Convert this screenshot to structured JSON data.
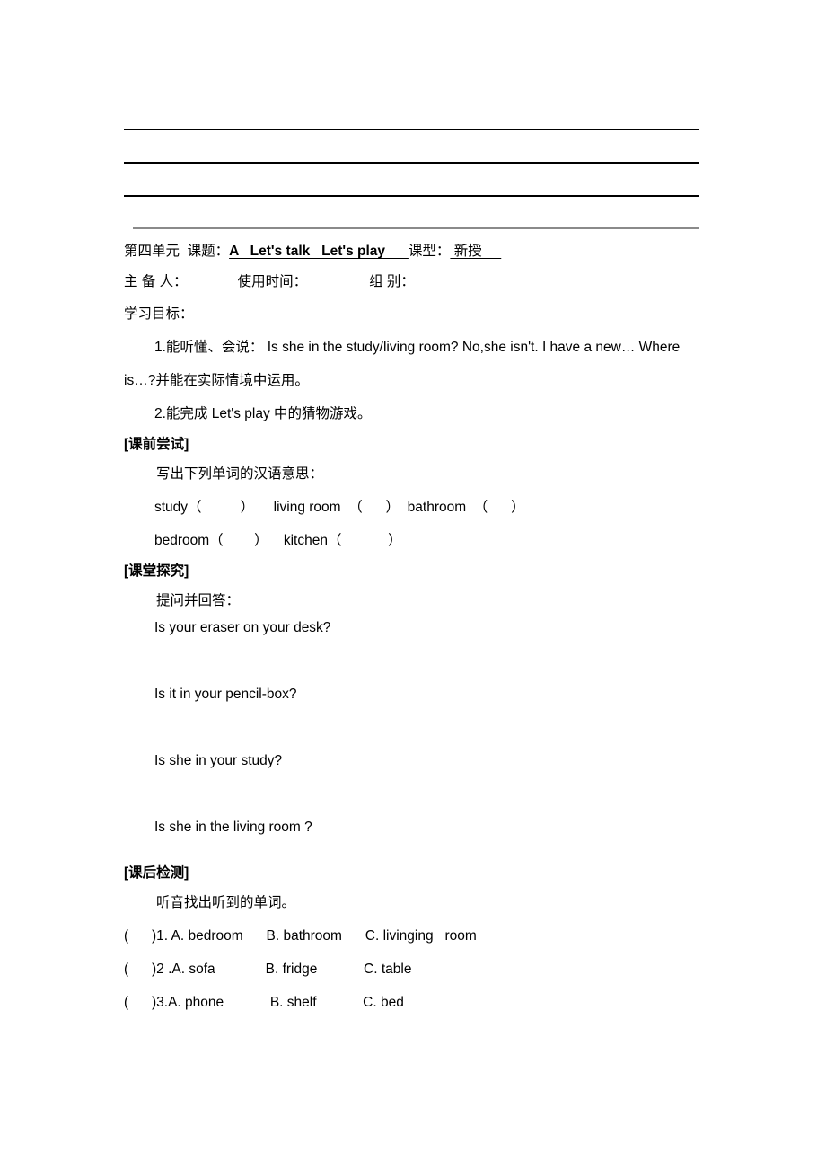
{
  "document": {
    "header": {
      "unit": "第四单元",
      "topic_label": "  课题：",
      "topic_value": "A   Let's talk   Let's play      ",
      "lesson_type_label": "课型：",
      "lesson_type_value": " 新授     ",
      "preparer_line": "主 备 人：",
      "preparer_blank": "____",
      "use_time_label": "     使用时间：",
      "use_time_blank": "________",
      "group_label": "组 别：",
      "group_blank": "_________"
    },
    "objectives": {
      "heading": "学习目标：",
      "items": [
        "1.能听懂、会说：   Is she in the study/living room?   No,she isn't.     I have a new…   Where is…?并能在实际情境中运用。",
        "2.能完成 Let's play 中的猜物游戏。"
      ]
    },
    "sections": [
      {
        "heading": "[课前尝试]",
        "instruction": "写出下列单词的汉语意思：",
        "vocab_rows": [
          "study（          ）     living room  （      ）  bathroom  （      ）",
          "bedroom（        ）    kitchen（            ）"
        ]
      },
      {
        "heading": "[课堂探究]",
        "instruction": "提问并回答：",
        "questions": [
          "Is your eraser on your desk?",
          "Is it in your pencil-box?",
          "Is she in your study?",
          "Is she in the living room ?"
        ]
      },
      {
        "heading": "[课后检测]",
        "instruction": "听音找出听到的单词。",
        "options": [
          "(      )1. A. bedroom      B. bathroom      C. livinging   room",
          "(      )2 .A. sofa             B. fridge            C. table",
          "(      )3.A. phone            B. shelf            C. bed"
        ]
      }
    ]
  }
}
